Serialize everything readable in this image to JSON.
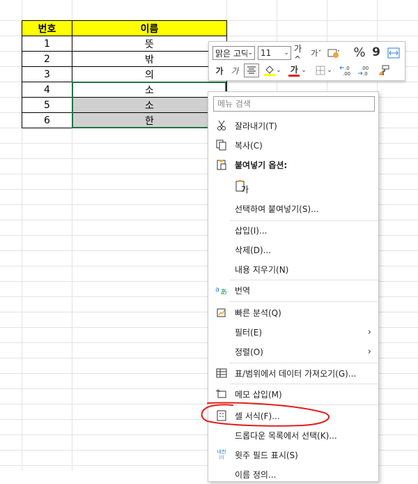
{
  "table": {
    "headers": [
      "번호",
      "이름"
    ],
    "rows": [
      {
        "num": "1",
        "name": "뜻"
      },
      {
        "num": "2",
        "name": "밖"
      },
      {
        "num": "3",
        "name": "의"
      },
      {
        "num": "4",
        "name": "소"
      },
      {
        "num": "5",
        "name": "소"
      },
      {
        "num": "6",
        "name": "한"
      }
    ]
  },
  "mini_toolbar": {
    "font_name": "맑은 고딕",
    "font_size": "11",
    "increase_font": "가^",
    "decrease_font": "가ˇ",
    "percent": "%",
    "comma": "9",
    "bold": "가",
    "italic": "가",
    "font_color_glyph": "가",
    "inc_decimal": "←.0 .00",
    "dec_decimal": ".00 →.0"
  },
  "menu": {
    "search_placeholder": "메뉴 검색",
    "items": [
      {
        "label": "잘라내기(T)",
        "icon": "scissors-icon"
      },
      {
        "label": "복사(C)",
        "icon": "copy-icon"
      },
      {
        "label": "붙여넣기 옵션:",
        "icon": "paste-icon"
      },
      {
        "label": "가",
        "icon": "paste-option-icon"
      },
      {
        "label": "선택하여 붙여넣기(S)...",
        "icon": ""
      },
      {
        "label": "삽입(I)...",
        "icon": ""
      },
      {
        "label": "삭제(D)...",
        "icon": ""
      },
      {
        "label": "내용 지우기(N)",
        "icon": ""
      },
      {
        "label": "번역",
        "icon": "translate-icon"
      },
      {
        "label": "빠른 분석(Q)",
        "icon": "quick-analysis-icon"
      },
      {
        "label": "필터(E)",
        "icon": ""
      },
      {
        "label": "정렬(O)",
        "icon": ""
      },
      {
        "label": "표/범위에서 데이터 가져오기(G)...",
        "icon": "table-icon"
      },
      {
        "label": "메모 삽입(M)",
        "icon": "comment-icon"
      },
      {
        "label": "셀 서식(F)...",
        "icon": "format-cells-icon"
      },
      {
        "label": "드롭다운 목록에서 선택(K)...",
        "icon": ""
      },
      {
        "label": "윗주 필드 표시(S)",
        "icon": "phonetic-icon"
      },
      {
        "label": "이름 정의...",
        "icon": ""
      }
    ],
    "phonetic_icon_text": "내천 川",
    "submenu_arrow": "›"
  },
  "annotation_color": "#e0201b",
  "selection_color": "#217346",
  "header_fill": "#ffff00"
}
